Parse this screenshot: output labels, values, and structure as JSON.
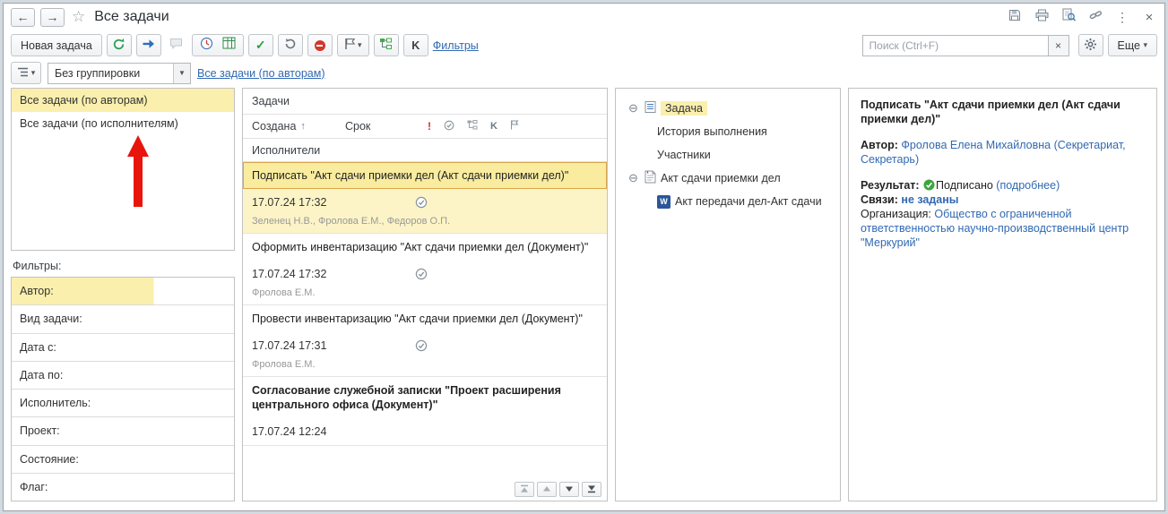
{
  "colors": {
    "selection_yellow": "#FAEFAD",
    "selection_border": "#D8A64A",
    "link_blue": "#3169B2",
    "success_green": "#3DA53D",
    "stop_red": "#D2372C",
    "annotation_red": "#E8150D"
  },
  "icons": {
    "back": "←",
    "forward": "→",
    "star": "☆",
    "kebab": "⋮",
    "close": "×",
    "check": "✓",
    "caret_down": "▾",
    "combo_arrow": "▼",
    "sort_asc": "↑",
    "priority": "!",
    "expander": "⊖",
    "word": "W",
    "k": "K"
  },
  "titlebar": {
    "title": "Все задачи"
  },
  "toolbar": {
    "new_task_label": "Новая задача",
    "filters_link": "Фильтры",
    "search_placeholder": "Поиск (Ctrl+F)",
    "more_label": "Еще"
  },
  "grouping": {
    "combo_value": "Без группировки",
    "view_link": "Все задачи (по авторам)"
  },
  "left_panel": {
    "views": [
      {
        "label": "Все задачи (по авторам)"
      },
      {
        "label": "Все задачи (по исполнителям)"
      }
    ],
    "filters_title": "Фильтры:",
    "filters": [
      {
        "label": "Автор:"
      },
      {
        "label": "Вид задачи:"
      },
      {
        "label": "Дата с:"
      },
      {
        "label": "Дата по:"
      },
      {
        "label": "Исполнитель:"
      },
      {
        "label": "Проект:"
      },
      {
        "label": "Состояние:"
      },
      {
        "label": "Флаг:"
      }
    ]
  },
  "tasks": {
    "panel_title": "Задачи",
    "col_created": "Создана",
    "col_due": "Срок",
    "col_executors": "Исполнители",
    "rows": [
      {
        "title": "Подписать \"Акт сдачи приемки дел (Акт сдачи приемки дел)\"",
        "created": "17.07.24 17:32",
        "executors": "Зеленец Н.В., Фролова Е.М., Федоров О.П."
      },
      {
        "title": "Оформить инвентаризацию \"Акт сдачи приемки дел (Документ)\"",
        "created": "17.07.24 17:32",
        "executors": "Фролова Е.М."
      },
      {
        "title": "Провести инвентаризацию \"Акт сдачи приемки дел (Документ)\"",
        "created": "17.07.24 17:31",
        "executors": "Фролова Е.М."
      },
      {
        "title": "Согласование служебной записки \"Проект расширения центрального офиса (Документ)\"",
        "created": "17.07.24 12:24",
        "executors": ""
      }
    ]
  },
  "tree": {
    "items": [
      {
        "label": "Задача"
      },
      {
        "label": "История выполнения"
      },
      {
        "label": "Участники"
      },
      {
        "label": "Акт сдачи приемки дел"
      },
      {
        "label": "Акт передачи дел-Акт сдачи"
      }
    ]
  },
  "details": {
    "title": "Подписать \"Акт сдачи приемки дел (Акт сдачи приемки дел)\"",
    "author_label": "Автор:",
    "author_value": "Фролова Елена Михайловна (Секретариат, Секретарь)",
    "result_label": "Результат:",
    "result_value": "Подписано",
    "result_more": "(подробнее)",
    "links_label": "Связи:",
    "links_value": "не заданы",
    "org_label": "Организация:",
    "org_value": "Общество с ограниченной ответственностью научно-производственный центр \"Меркурий\""
  }
}
